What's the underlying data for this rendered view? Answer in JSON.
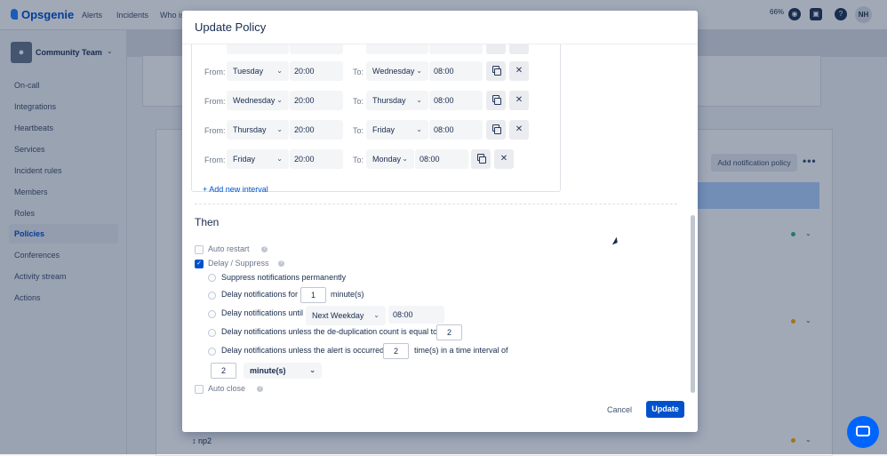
{
  "app": {
    "brand": "Opsgenie",
    "nav": [
      "Alerts",
      "Incidents",
      "Who is"
    ],
    "zoom": "66%",
    "user_initials": "NH",
    "team_name": "Community Team",
    "sidebar": [
      "On-call",
      "Integrations",
      "Heartbeats",
      "Services",
      "Incident rules",
      "Members",
      "Roles",
      "Policies",
      "Conferences",
      "Activity stream",
      "Actions"
    ],
    "active_sidebar": "Policies",
    "add_policy_label": "Add notification policy",
    "row_label": "np2",
    "colors": {
      "accent": "#0052cc",
      "green": "#36b37e",
      "yellow": "#ffab00"
    }
  },
  "modal": {
    "title": "Update Policy",
    "intervals": [
      {
        "from_label": "From:",
        "from_day": "Tuesday",
        "from_time": "20:00",
        "to_label": "To:",
        "to_day": "Wednesday",
        "to_time": "08:00"
      },
      {
        "from_label": "From:",
        "from_day": "Wednesday",
        "from_time": "20:00",
        "to_label": "To:",
        "to_day": "Thursday",
        "to_time": "08:00"
      },
      {
        "from_label": "From:",
        "from_day": "Thursday",
        "from_time": "20:00",
        "to_label": "To:",
        "to_day": "Friday",
        "to_time": "08:00"
      },
      {
        "from_label": "From:",
        "from_day": "Friday",
        "from_time": "20:00",
        "to_label": "To:",
        "to_day": "Monday",
        "to_time": "08:00"
      }
    ],
    "add_interval": "+ Add new interval",
    "then_heading": "Then",
    "auto_restart": {
      "label": "Auto restart",
      "checked": false
    },
    "delay_suppress": {
      "label": "Delay / Suppress",
      "checked": true
    },
    "options": {
      "suppress": "Suppress notifications permanently",
      "delay_for_prefix": "Delay notifications for",
      "delay_for_value": "1",
      "delay_for_unit": "minute(s)",
      "delay_until_prefix": "Delay notifications until",
      "delay_until_select": "Next Weekday",
      "delay_until_time": "08:00",
      "dedup_prefix": "Delay notifications unless the de-duplication count is equal to",
      "dedup_value": "2",
      "occurred_prefix": "Delay notifications unless the alert is occurred",
      "occurred_value": "2",
      "occurred_suffix": "time(s) in a time interval of",
      "interval_value": "2",
      "interval_unit": "minute(s)"
    },
    "auto_close": {
      "label": "Auto close",
      "checked": false
    },
    "cancel_label": "Cancel",
    "update_label": "Update"
  }
}
